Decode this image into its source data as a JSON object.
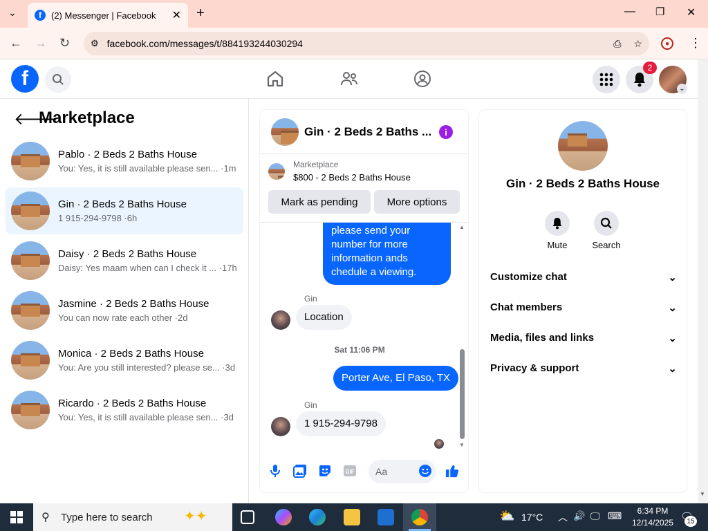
{
  "browser": {
    "tab_title": "(2) Messenger | Facebook",
    "url": "facebook.com/messages/t/884193244030294",
    "new_tab": "+",
    "tab_close": "✕"
  },
  "fb": {
    "logo": "f",
    "notifications_count": "2"
  },
  "left": {
    "title": "Marketplace",
    "conversations": [
      {
        "name": "Pablo · 2 Beds 2 Baths House",
        "preview": "You: Yes, it is still available please sen... ·1m",
        "selected": false
      },
      {
        "name": "Gin · 2 Beds 2 Baths House",
        "preview": "1 915-294-9798 ·6h",
        "selected": true
      },
      {
        "name": "Daisy · 2 Beds 2 Baths House",
        "preview": "Daisy: Yes maam when can I check it ... ·17h",
        "selected": false
      },
      {
        "name": "Jasmine · 2 Beds 2 Baths House",
        "preview": "You can now rate each other ·2d",
        "selected": false
      },
      {
        "name": "Monica · 2 Beds 2 Baths House",
        "preview": "You: Are you still interested? please se... ·3d",
        "selected": false
      },
      {
        "name": "Ricardo · 2 Beds 2 Baths House",
        "preview": "You: Yes, it is still available please sen... ·3d",
        "selected": false
      }
    ]
  },
  "chat": {
    "title": "Gin · 2 Beds 2 Baths ...",
    "marketplace_label": "Marketplace",
    "listing": "$800 - 2 Beds 2 Baths House",
    "mark_pending": "Mark as pending",
    "more_options": "More options",
    "msg_out_1": "please send your number for more information ands chedule a viewing.",
    "sender_1": "Gin",
    "msg_in_1": "Location",
    "timestamp": "Sat 11:06 PM",
    "msg_out_2": "Porter Ave, El Paso, TX",
    "sender_2": "Gin",
    "msg_in_2": "1 915-294-9798",
    "input_placeholder": "Aa"
  },
  "right": {
    "name": "Gin · 2 Beds 2 Baths House",
    "mute": "Mute",
    "search": "Search",
    "sections": [
      "Customize chat",
      "Chat members",
      "Media, files and links",
      "Privacy & support"
    ]
  },
  "taskbar": {
    "search_placeholder": "Type here to search",
    "weather": "17°C",
    "time": "6:34 PM",
    "date": "12/14/2025",
    "notif_count": "15"
  }
}
